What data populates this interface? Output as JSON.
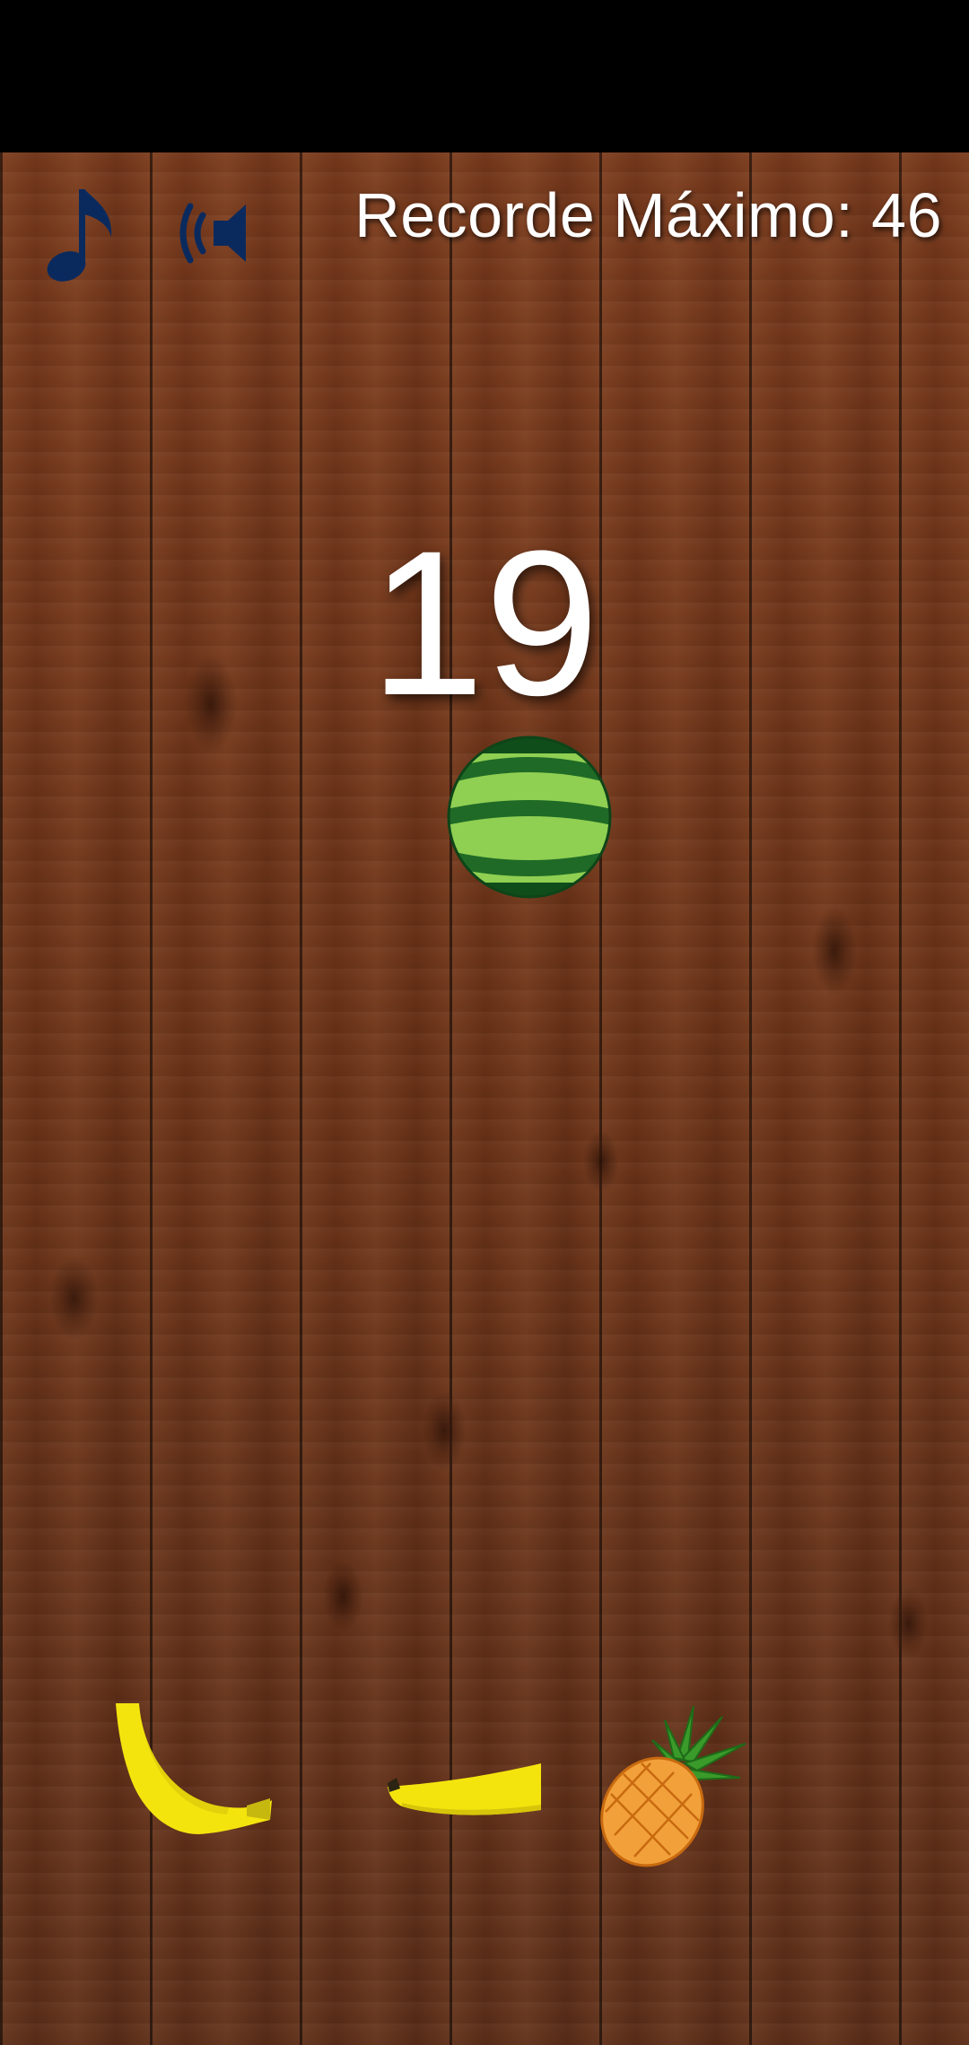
{
  "hud": {
    "music_icon": "music-note-icon",
    "sound_icon": "speaker-sound-icon",
    "best_score_text": "Recorde Máximo: 46",
    "score": "19"
  },
  "fruits": [
    {
      "name": "watermelon"
    },
    {
      "name": "banana"
    },
    {
      "name": "banana"
    },
    {
      "name": "pineapple"
    }
  ],
  "colors": {
    "icon": "#0a2a5e",
    "text": "#ffffff",
    "wood": "#6e3418"
  }
}
